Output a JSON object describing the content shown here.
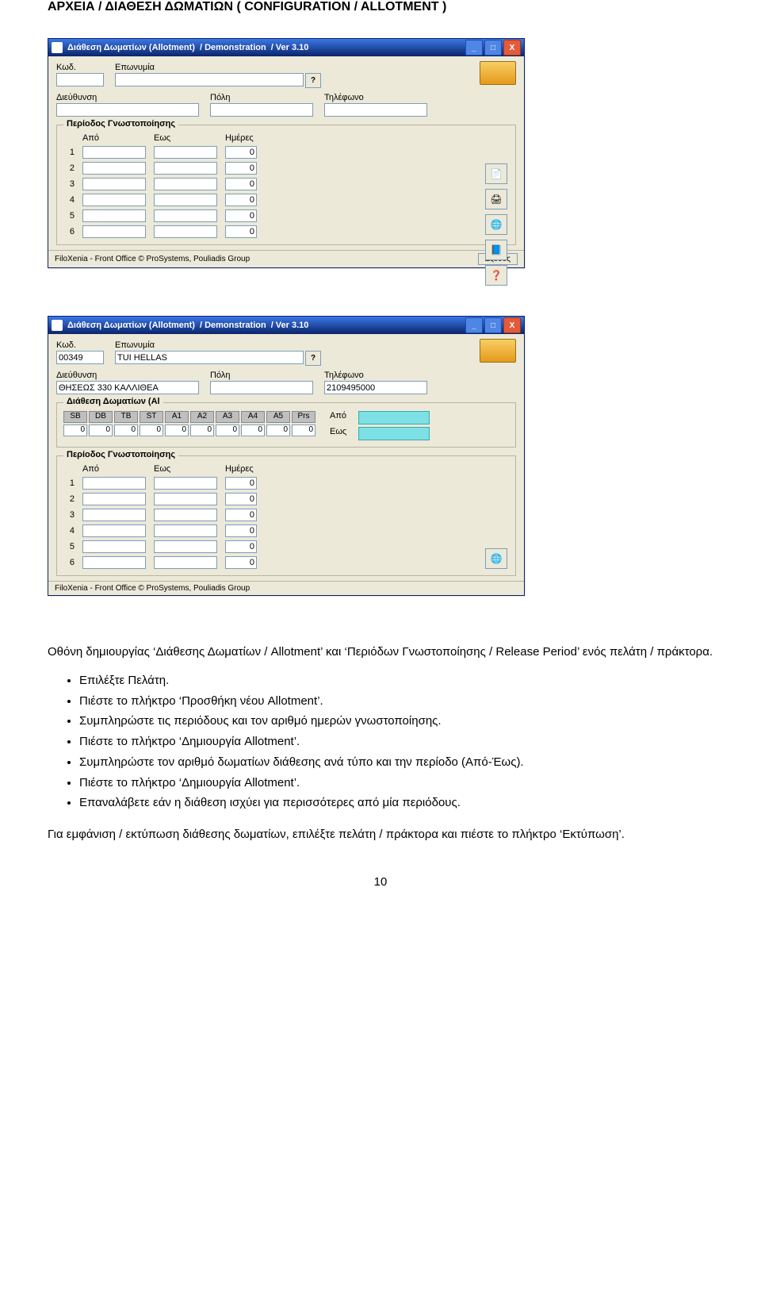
{
  "page_heading": "ΑΡΧΕΙΑ / ΔΙΑΘΕΣΗ ΔΩΜΑΤΙΩΝ ( CONFIGURATION / ALLOTMENT  )",
  "window": {
    "title_main": "Διάθεση Δωματίων (Allotment)",
    "title_demo": "/ Demonstration",
    "title_ver": "/  Ver  3.10",
    "labels": {
      "kod": "Κωδ.",
      "eponymia": "Επωνυμία",
      "dieuthynsi": "Διεύθυνση",
      "poli": "Πόλη",
      "tilefono": "Τηλέφωνο",
      "periodos_group": "Περίοδος Γνωστοποίησης",
      "apo": "Από",
      "eos": "Εως",
      "imeres": "Ημέρες",
      "diathesi_group": "Διάθεση Δωματίων (Al",
      "apo2": "Από",
      "eos2": "Εως"
    },
    "status_text": "FiloXenia - Front Office   © ProSystems,   Pouliadis Group",
    "exit_label": "Εξοδος",
    "question": "?",
    "rows": [
      "1",
      "2",
      "3",
      "4",
      "5",
      "6"
    ],
    "imeres_values": [
      "0",
      "0",
      "0",
      "0",
      "0",
      "0"
    ],
    "data2": {
      "kod": "00349",
      "eponymia": "TUI HELLAS",
      "dieuthynsi": "ΘΗΣΕΩΣ 330 ΚΑΛΛΙΘΕΑ",
      "poli": "",
      "tilefono": "2109495000",
      "allot_headers": [
        "SB",
        "DB",
        "TB",
        "ST",
        "A1",
        "A2",
        "A3",
        "A4",
        "A5",
        "Prs"
      ],
      "allot_values": [
        "0",
        "0",
        "0",
        "0",
        "0",
        "0",
        "0",
        "0",
        "0",
        "0"
      ]
    },
    "icons": {
      "win_min": "_",
      "win_max": "□",
      "win_close": "X",
      "tool1": "📄",
      "tool2": "🖨",
      "tool3": "🌐",
      "tool4": "📘",
      "tool5": "❓",
      "tool_single": "🌐"
    }
  },
  "body": {
    "p1": "Οθόνη δημιουργίας ‘Διάθεσης Δωματίων / Allotment’ και ‘Περιόδων Γνωστοποίησης  / Release Period’ ενός πελάτη  / πράκτορα.",
    "li1": "Επιλέξτε Πελάτη.",
    "li2": "Πιέστε το πλήκτρο ‘Προσθήκη νέου Allotment’.",
    "li3": "Συμπληρώστε τις περιόδους και τον αριθμό ημερών γνωστοποίησης.",
    "li4": "Πιέστε το πλήκτρο ‘Δημιουργία Allotment’.",
    "li5": "Συμπληρώστε τον αριθμό δωματίων διάθεσης ανά τύπο και την περίοδο (Από-Έως).",
    "li6": "Πιέστε το πλήκτρο ‘Δημιουργία Allotment’.",
    "li7": "Επαναλάβετε εάν η διάθεση ισχύει για περισσότερες από μία περιόδους.",
    "p2": "Για εμφάνιση / εκτύπωση διάθεσης δωματίων, επιλέξτε πελάτη / πράκτορα και πιέστε το πλήκτρο  ‘Εκτύπωση’.",
    "page_num": "10"
  }
}
